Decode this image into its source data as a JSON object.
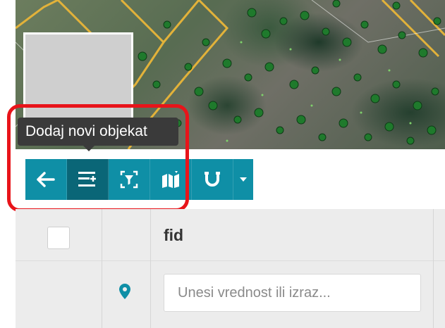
{
  "tooltip": {
    "text": "Dodaj novi objekat"
  },
  "toolbar": {
    "buttons": [
      {
        "icon": "arrow-left-icon"
      },
      {
        "icon": "add-feature-icon",
        "active": true
      },
      {
        "icon": "select-filter-icon"
      },
      {
        "icon": "map-layers-icon"
      },
      {
        "icon": "magnet-icon"
      },
      {
        "icon": "chevron-down-icon"
      }
    ],
    "color": "#0f8fa6",
    "active_color": "#0a6677"
  },
  "highlight": {
    "color": "#e8141a"
  },
  "table": {
    "columns": [
      {
        "header": "fid"
      }
    ],
    "filter": {
      "placeholder": "Unesi vrednost ili izraz..."
    },
    "pin_color": "#0f8fa6"
  }
}
